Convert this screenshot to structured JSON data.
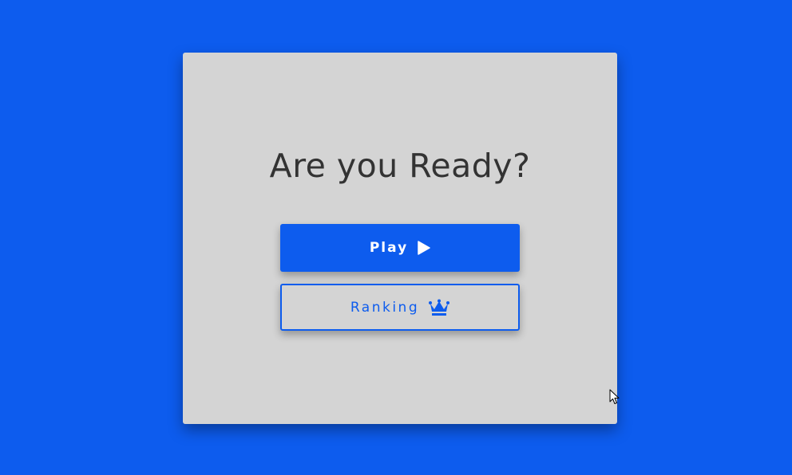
{
  "dialog": {
    "title": "Are you Ready?",
    "play_label": "Play",
    "ranking_label": "Ranking"
  },
  "icons": {
    "play": "play-icon",
    "ranking": "crown-icon"
  },
  "colors": {
    "background": "#0d5cee",
    "card": "#d4d4d4",
    "title_text": "#333333",
    "accent": "#0d5cee"
  }
}
